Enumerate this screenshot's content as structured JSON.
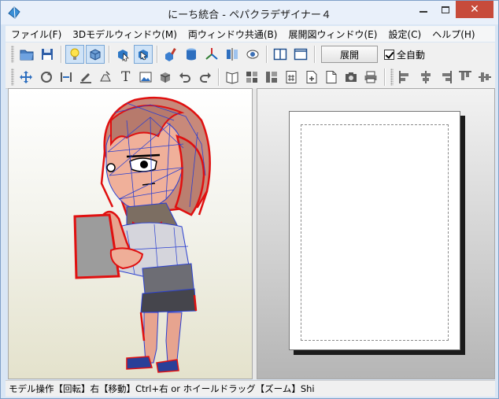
{
  "window": {
    "title": "にーち統合 - ペパクラデザイナー４",
    "close_glyph": "✕"
  },
  "menu": {
    "items": [
      "ファイル(F)",
      "3Dモデルウィンドウ(M)",
      "両ウィンドウ共通(B)",
      "展開図ウィンドウ(E)",
      "設定(C)",
      "ヘルプ(H)"
    ]
  },
  "toolbar1": {
    "expand_label": "展開",
    "auto_label": "全自動",
    "auto_checked": true
  },
  "toolbar2": {
    "text_tool_glyph": "T"
  },
  "status": {
    "text": "モデル操作【回転】右【移動】Ctrl+右 or ホイールドラッグ【ズーム】Shi"
  },
  "colors": {
    "close_button": "#c74b3b",
    "wire_edge": "#e01010",
    "mesh_line": "#2a3fd0",
    "active_button": "#cfe3f7"
  }
}
